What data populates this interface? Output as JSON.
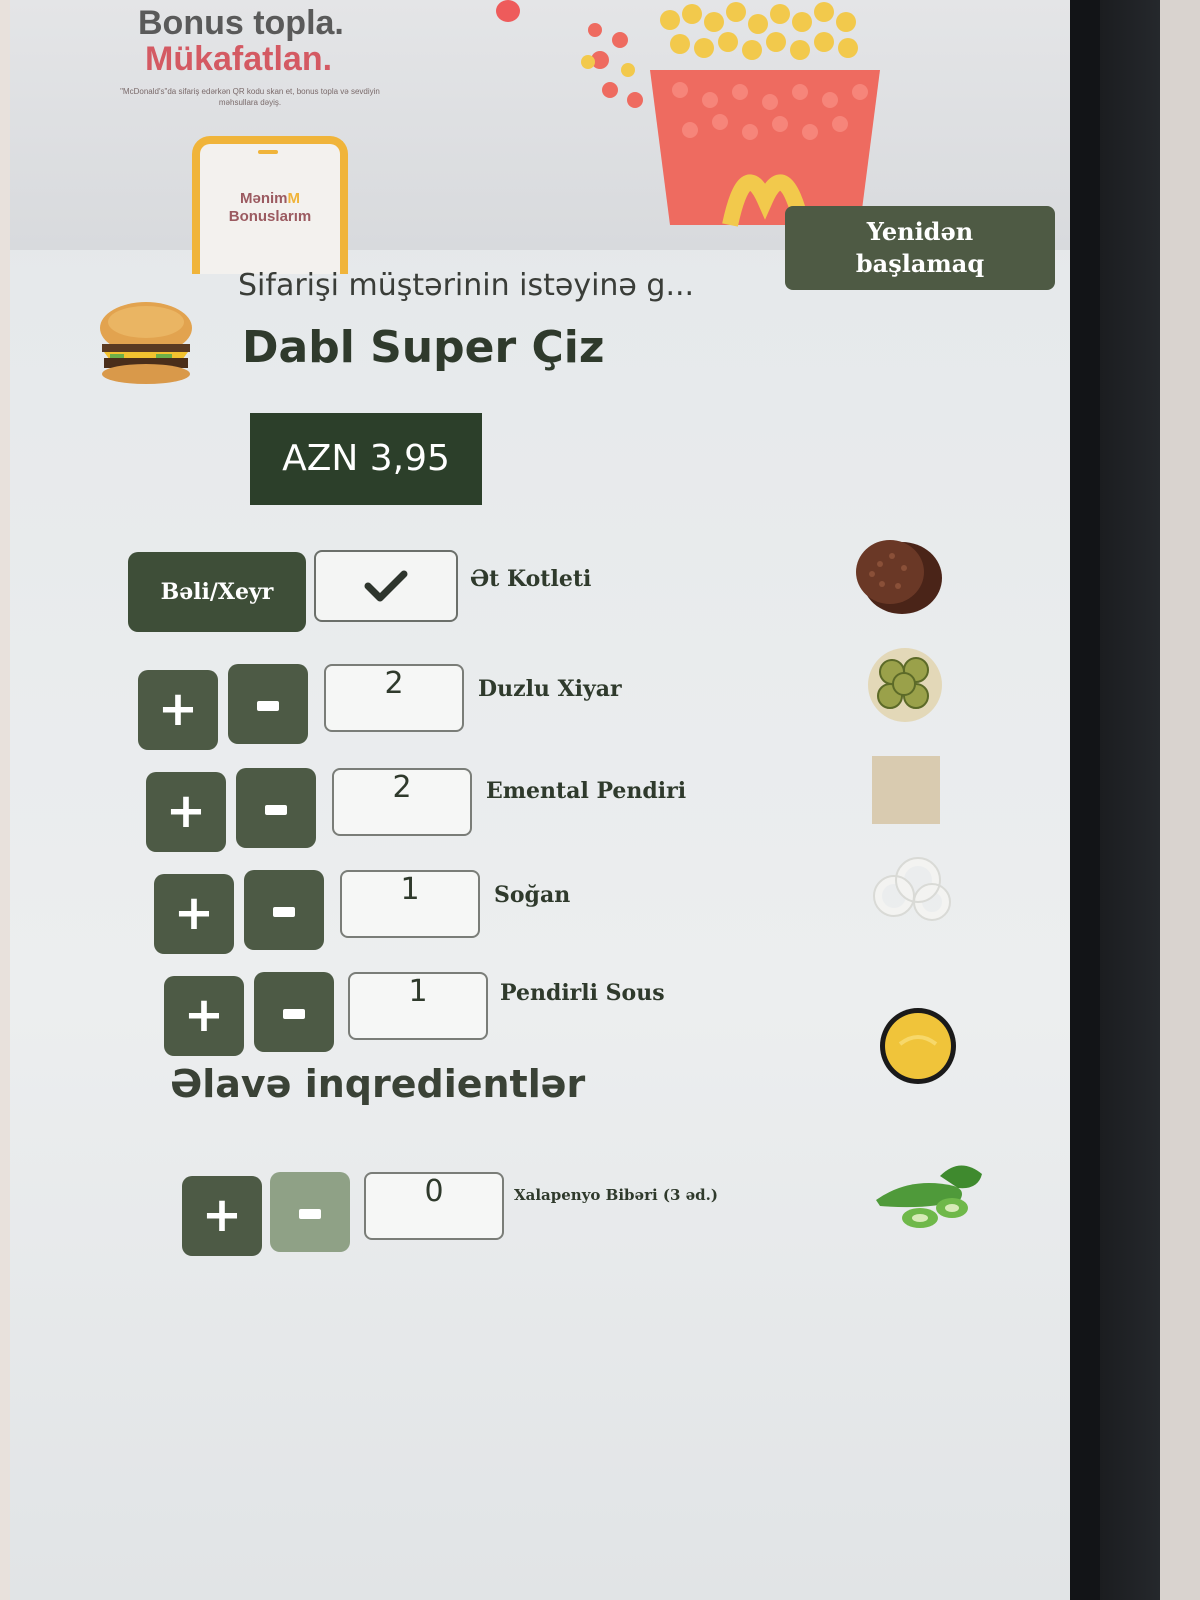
{
  "banner": {
    "title_line1": "Bonus topla.",
    "title_line2": "Mükafatlan.",
    "small_text": "\"McDonald's\"da sifariş edərkən QR kodu skan et, bonus topla və sevdiyin məhsullara dəyiş.",
    "phone_label_line1": "Mənim",
    "phone_label_line2": "Bonuslarım"
  },
  "header": {
    "restart_line1": "Yenidən",
    "restart_line2": "başlamaq",
    "subtitle": "Sifarişi müştərinin istəyinə g...",
    "product_name": "Dabl Super Çiz",
    "price": "AZN 3,95"
  },
  "ingredients": [
    {
      "name": "Ət Kotleti",
      "control": "yes-no",
      "button_label": "Bəli/Xeyr",
      "checked": true
    },
    {
      "name": "Duzlu Xiyar",
      "quantity": "2"
    },
    {
      "name": "Emental Pendiri",
      "quantity": "2"
    },
    {
      "name": "Soğan",
      "quantity": "1"
    },
    {
      "name": "Pendirli Sous",
      "quantity": "1"
    }
  ],
  "extras": {
    "title": "Əlavə inqredientlər",
    "items": [
      {
        "name": "Xalapenyo Bibəri (3 əd.)",
        "quantity": "0"
      }
    ]
  },
  "controls": {
    "plus": "+"
  },
  "colors": {
    "accent_dark": "#2c3f2a",
    "button": "#4d5a45",
    "button_disabled": "#8fa186",
    "brand_red": "#d45a63",
    "brand_yellow": "#f0b43a"
  },
  "icons": [
    "check-icon",
    "plus-icon",
    "minus-icon",
    "burger-image",
    "patty-image",
    "pickle-image",
    "cheese-image",
    "onion-image",
    "sauce-image",
    "jalapeno-image"
  ]
}
